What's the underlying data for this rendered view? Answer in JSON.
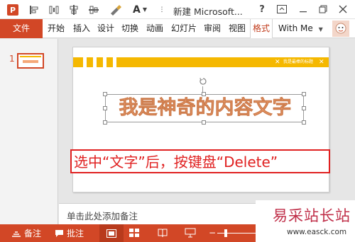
{
  "app": {
    "window_title": "新建 Microsoft...",
    "help": "?",
    "font_color_letter": "A"
  },
  "ribbon": {
    "tabs": [
      "文件",
      "开始",
      "插入",
      "设计",
      "切换",
      "动画",
      "幻灯片",
      "审阅",
      "视图",
      "格式"
    ],
    "selected_tab": "格式",
    "account": "With Me"
  },
  "thumbnails": [
    {
      "number": "1"
    }
  ],
  "slide": {
    "header_text": "我是最棒的标题",
    "wordart_text": "我是神奇的内容文字",
    "instruction_text": "选中“文字”后，按键盘“Delete”"
  },
  "notes": {
    "placeholder": "单击此处添加备注"
  },
  "statusbar": {
    "notes_label": "备注",
    "comments_label": "批注"
  },
  "watermark": {
    "brand": "易采站长站",
    "url": "www.easck.com"
  },
  "colors": {
    "accent": "#d24726",
    "slide_bar": "#f5b800",
    "wordart_fill": "#f5a878",
    "instruction_red": "#e02020"
  }
}
